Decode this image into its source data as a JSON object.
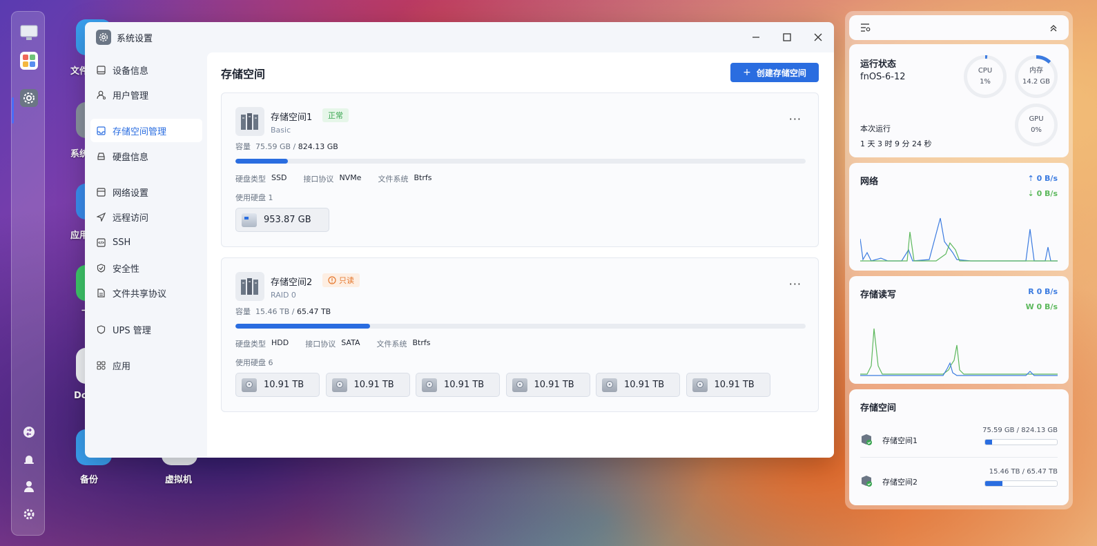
{
  "desktop": {
    "labels": [
      "文件",
      "系统",
      "应用",
      "下",
      "Do",
      "备份",
      "虚拟机"
    ]
  },
  "window": {
    "title": "系统设置",
    "sidebar": [
      {
        "label": "设备信息",
        "icon": "monitor-icon"
      },
      {
        "label": "用户管理",
        "icon": "user-icon"
      },
      {
        "label": "存储空间管理",
        "icon": "storage-icon",
        "active": true
      },
      {
        "label": "硬盘信息",
        "icon": "disk-icon"
      },
      {
        "label": "网络设置",
        "icon": "network-icon"
      },
      {
        "label": "远程访问",
        "icon": "remote-icon"
      },
      {
        "label": "SSH",
        "icon": "code-icon"
      },
      {
        "label": "安全性",
        "icon": "shield-icon"
      },
      {
        "label": "文件共享协议",
        "icon": "file-icon"
      },
      {
        "label": "UPS 管理",
        "icon": "ups-shield-icon"
      },
      {
        "label": "应用",
        "icon": "apps-icon"
      }
    ],
    "main": {
      "title": "存储空间",
      "create_button": "创建存储空间",
      "pools": [
        {
          "name": "存储空间1",
          "status": "正常",
          "raid": "Basic",
          "cap_label": "容量",
          "used": "75.59 GB",
          "total": "824.13 GB",
          "fill": 0.092,
          "disk_type_label": "硬盘类型",
          "disk_type": "SSD",
          "iface_label": "接口协议",
          "iface": "NVMe",
          "fs_label": "文件系统",
          "fs": "Btrfs",
          "disk_count_label": "使用硬盘 1",
          "disks": [
            "953.87 GB"
          ]
        },
        {
          "name": "存储空间2",
          "status": "只读",
          "raid": "RAID 0",
          "cap_label": "容量",
          "used": "15.46 TB",
          "total": "65.47 TB",
          "fill": 0.236,
          "disk_type_label": "硬盘类型",
          "disk_type": "HDD",
          "iface_label": "接口协议",
          "iface": "SATA",
          "fs_label": "文件系统",
          "fs": "Btrfs",
          "disk_count_label": "使用硬盘 6",
          "disks": [
            "10.91 TB",
            "10.91 TB",
            "10.91 TB",
            "10.91 TB",
            "10.91 TB",
            "10.91 TB"
          ]
        }
      ]
    }
  },
  "widgets": {
    "status": {
      "title": "运行状态",
      "hostname": "fnOS-6-12",
      "cpu_label": "CPU",
      "cpu_value": "1%",
      "cpu_fraction": 0.01,
      "mem_label": "内存",
      "mem_value": "14.2 GB",
      "mem_fraction": 0.12,
      "gpu_label": "GPU",
      "gpu_value": "0%",
      "gpu_fraction": 0,
      "uptime_label": "本次运行",
      "uptime": "1 天 3 时 9 分 24 秒"
    },
    "network": {
      "title": "网络",
      "up": "0 B/s",
      "down": "0 B/s"
    },
    "disk_io": {
      "title": "存储读写",
      "read": "R  0 B/s",
      "write": "W  0 B/s"
    },
    "storage": {
      "title": "存储空间",
      "items": [
        {
          "name": "存储空间1",
          "cap": "75.59 GB / 824.13 GB",
          "fill": 0.092
        },
        {
          "name": "存储空间2",
          "cap": "15.46 TB / 65.47 TB",
          "fill": 0.236
        }
      ]
    }
  },
  "colors": {
    "accent": "#2a6de0",
    "ok": "#3aa551",
    "warn": "#e4762c",
    "net_up": "#3b7be0",
    "net_down": "#5cb85c"
  }
}
